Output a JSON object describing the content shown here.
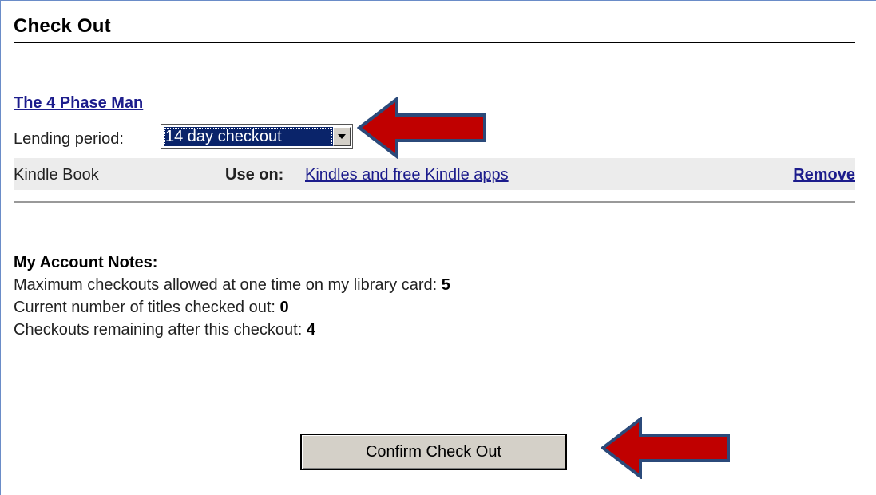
{
  "page": {
    "title": "Check Out"
  },
  "item": {
    "title": "The 4 Phase Man",
    "lending_label": "Lending period:",
    "lending_selected": "14 day checkout",
    "format": "Kindle Book",
    "use_on_label": "Use on:",
    "use_on_link": "Kindles and free Kindle apps",
    "remove_label": "Remove"
  },
  "notes": {
    "heading": "My Account Notes:",
    "lines": [
      {
        "label": "Maximum checkouts allowed at one time on my library card:",
        "value": "5"
      },
      {
        "label": "Current number of titles checked out:",
        "value": "0"
      },
      {
        "label": "Checkouts remaining after this checkout:",
        "value": "4"
      }
    ]
  },
  "actions": {
    "confirm_label": "Confirm Check Out"
  },
  "annotations": {
    "arrow_color": "#c00000",
    "arrow_outline": "#2b4a7a",
    "arrow_icon": "left-arrow-icon"
  }
}
